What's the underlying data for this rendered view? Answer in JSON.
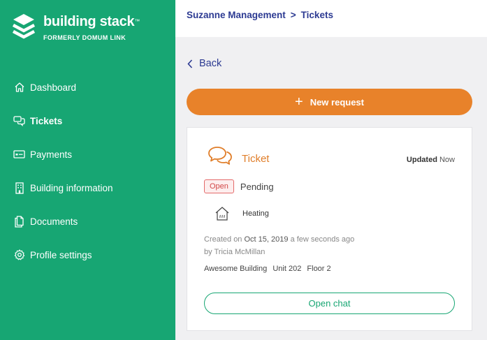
{
  "brand": {
    "name": "building stack",
    "trademark": "™",
    "subtitle": "FORMERLY DOMUM LINK",
    "icon": "stacked-layers-logo"
  },
  "sidebar": {
    "items": [
      {
        "label": "Dashboard",
        "icon": "home-icon",
        "active": false
      },
      {
        "label": "Tickets",
        "icon": "chat-bubbles-icon",
        "active": true
      },
      {
        "label": "Payments",
        "icon": "card-icon",
        "active": false
      },
      {
        "label": "Building information",
        "icon": "building-icon",
        "active": false
      },
      {
        "label": "Documents",
        "icon": "documents-icon",
        "active": false
      },
      {
        "label": "Profile settings",
        "icon": "gear-icon",
        "active": false
      }
    ]
  },
  "breadcrumb": {
    "parent": "Suzanne Management",
    "separator": ">",
    "current": "Tickets"
  },
  "back_label": "Back",
  "new_request": {
    "plus": "+",
    "label": "New request"
  },
  "ticket": {
    "title": "Ticket",
    "updated_label": "Updated",
    "updated_value": "Now",
    "status_badge": "Open",
    "status_text": "Pending",
    "category": "Heating",
    "created_prefix": "Created on",
    "created_date": "Oct 15, 2019",
    "created_relative": "a few seconds ago",
    "by_prefix": "by",
    "author": "Tricia McMillan",
    "building": "Awesome Building",
    "unit": "Unit 202",
    "floor": "Floor 2",
    "open_chat_label": "Open chat"
  },
  "colors": {
    "sidebar": "#17a673",
    "accent_orange": "#e8822a",
    "link_blue": "#2c3a92",
    "badge_red": "#d24848"
  }
}
